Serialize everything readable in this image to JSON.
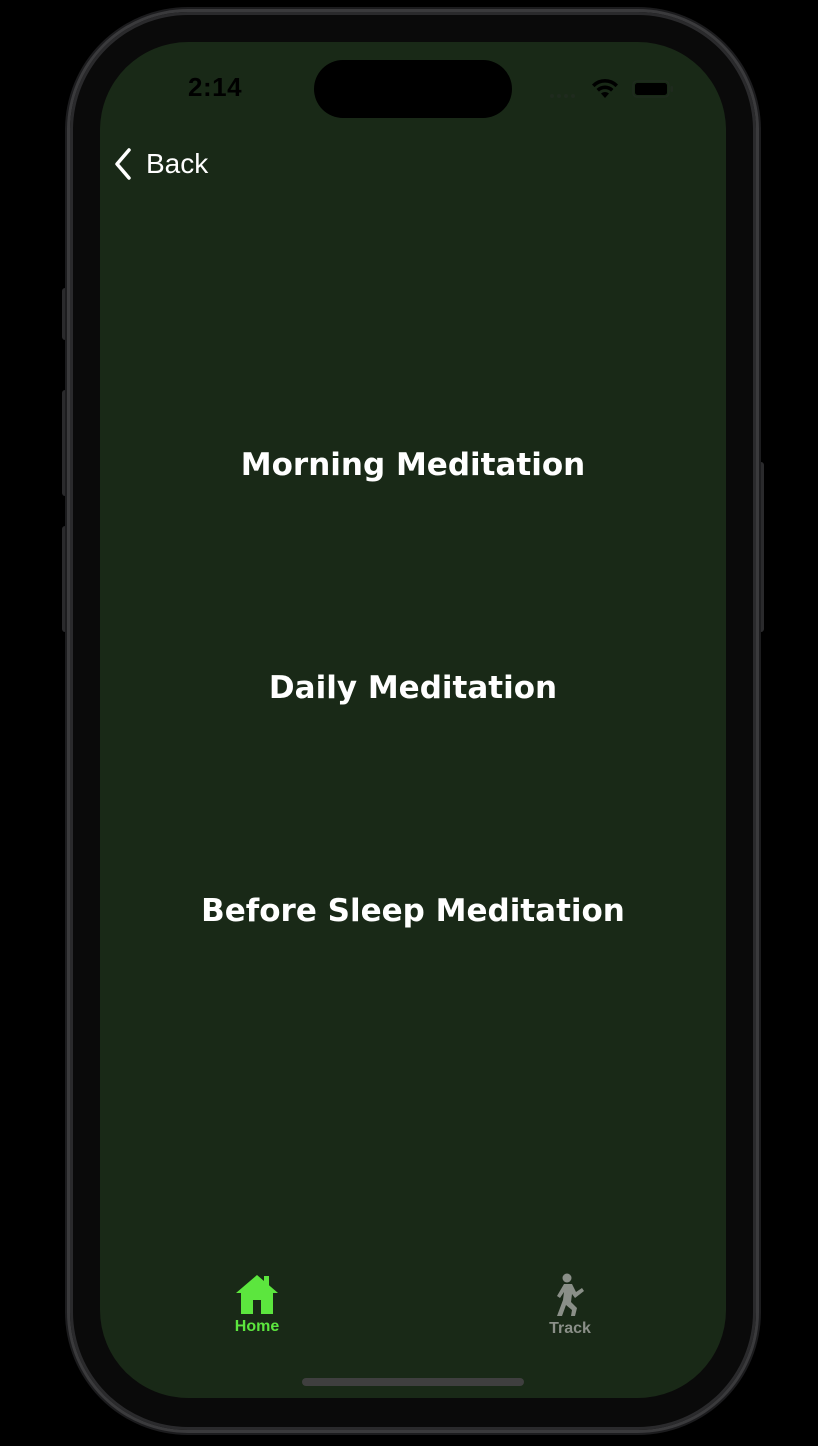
{
  "status_bar": {
    "time": "2:14"
  },
  "nav": {
    "back_label": "Back"
  },
  "menu": {
    "items": [
      {
        "label": "Morning Meditation"
      },
      {
        "label": "Daily Meditation"
      },
      {
        "label": "Before Sleep Meditation"
      }
    ]
  },
  "tab_bar": {
    "tabs": [
      {
        "label": "Home",
        "icon": "house-icon",
        "active": true
      },
      {
        "label": "Track",
        "icon": "walking-figure-icon",
        "active": false
      }
    ]
  },
  "colors": {
    "screen_background": "#192917",
    "active_tab": "#5ce63e",
    "inactive_tab": "#8a8f88",
    "text": "#ffffff"
  }
}
